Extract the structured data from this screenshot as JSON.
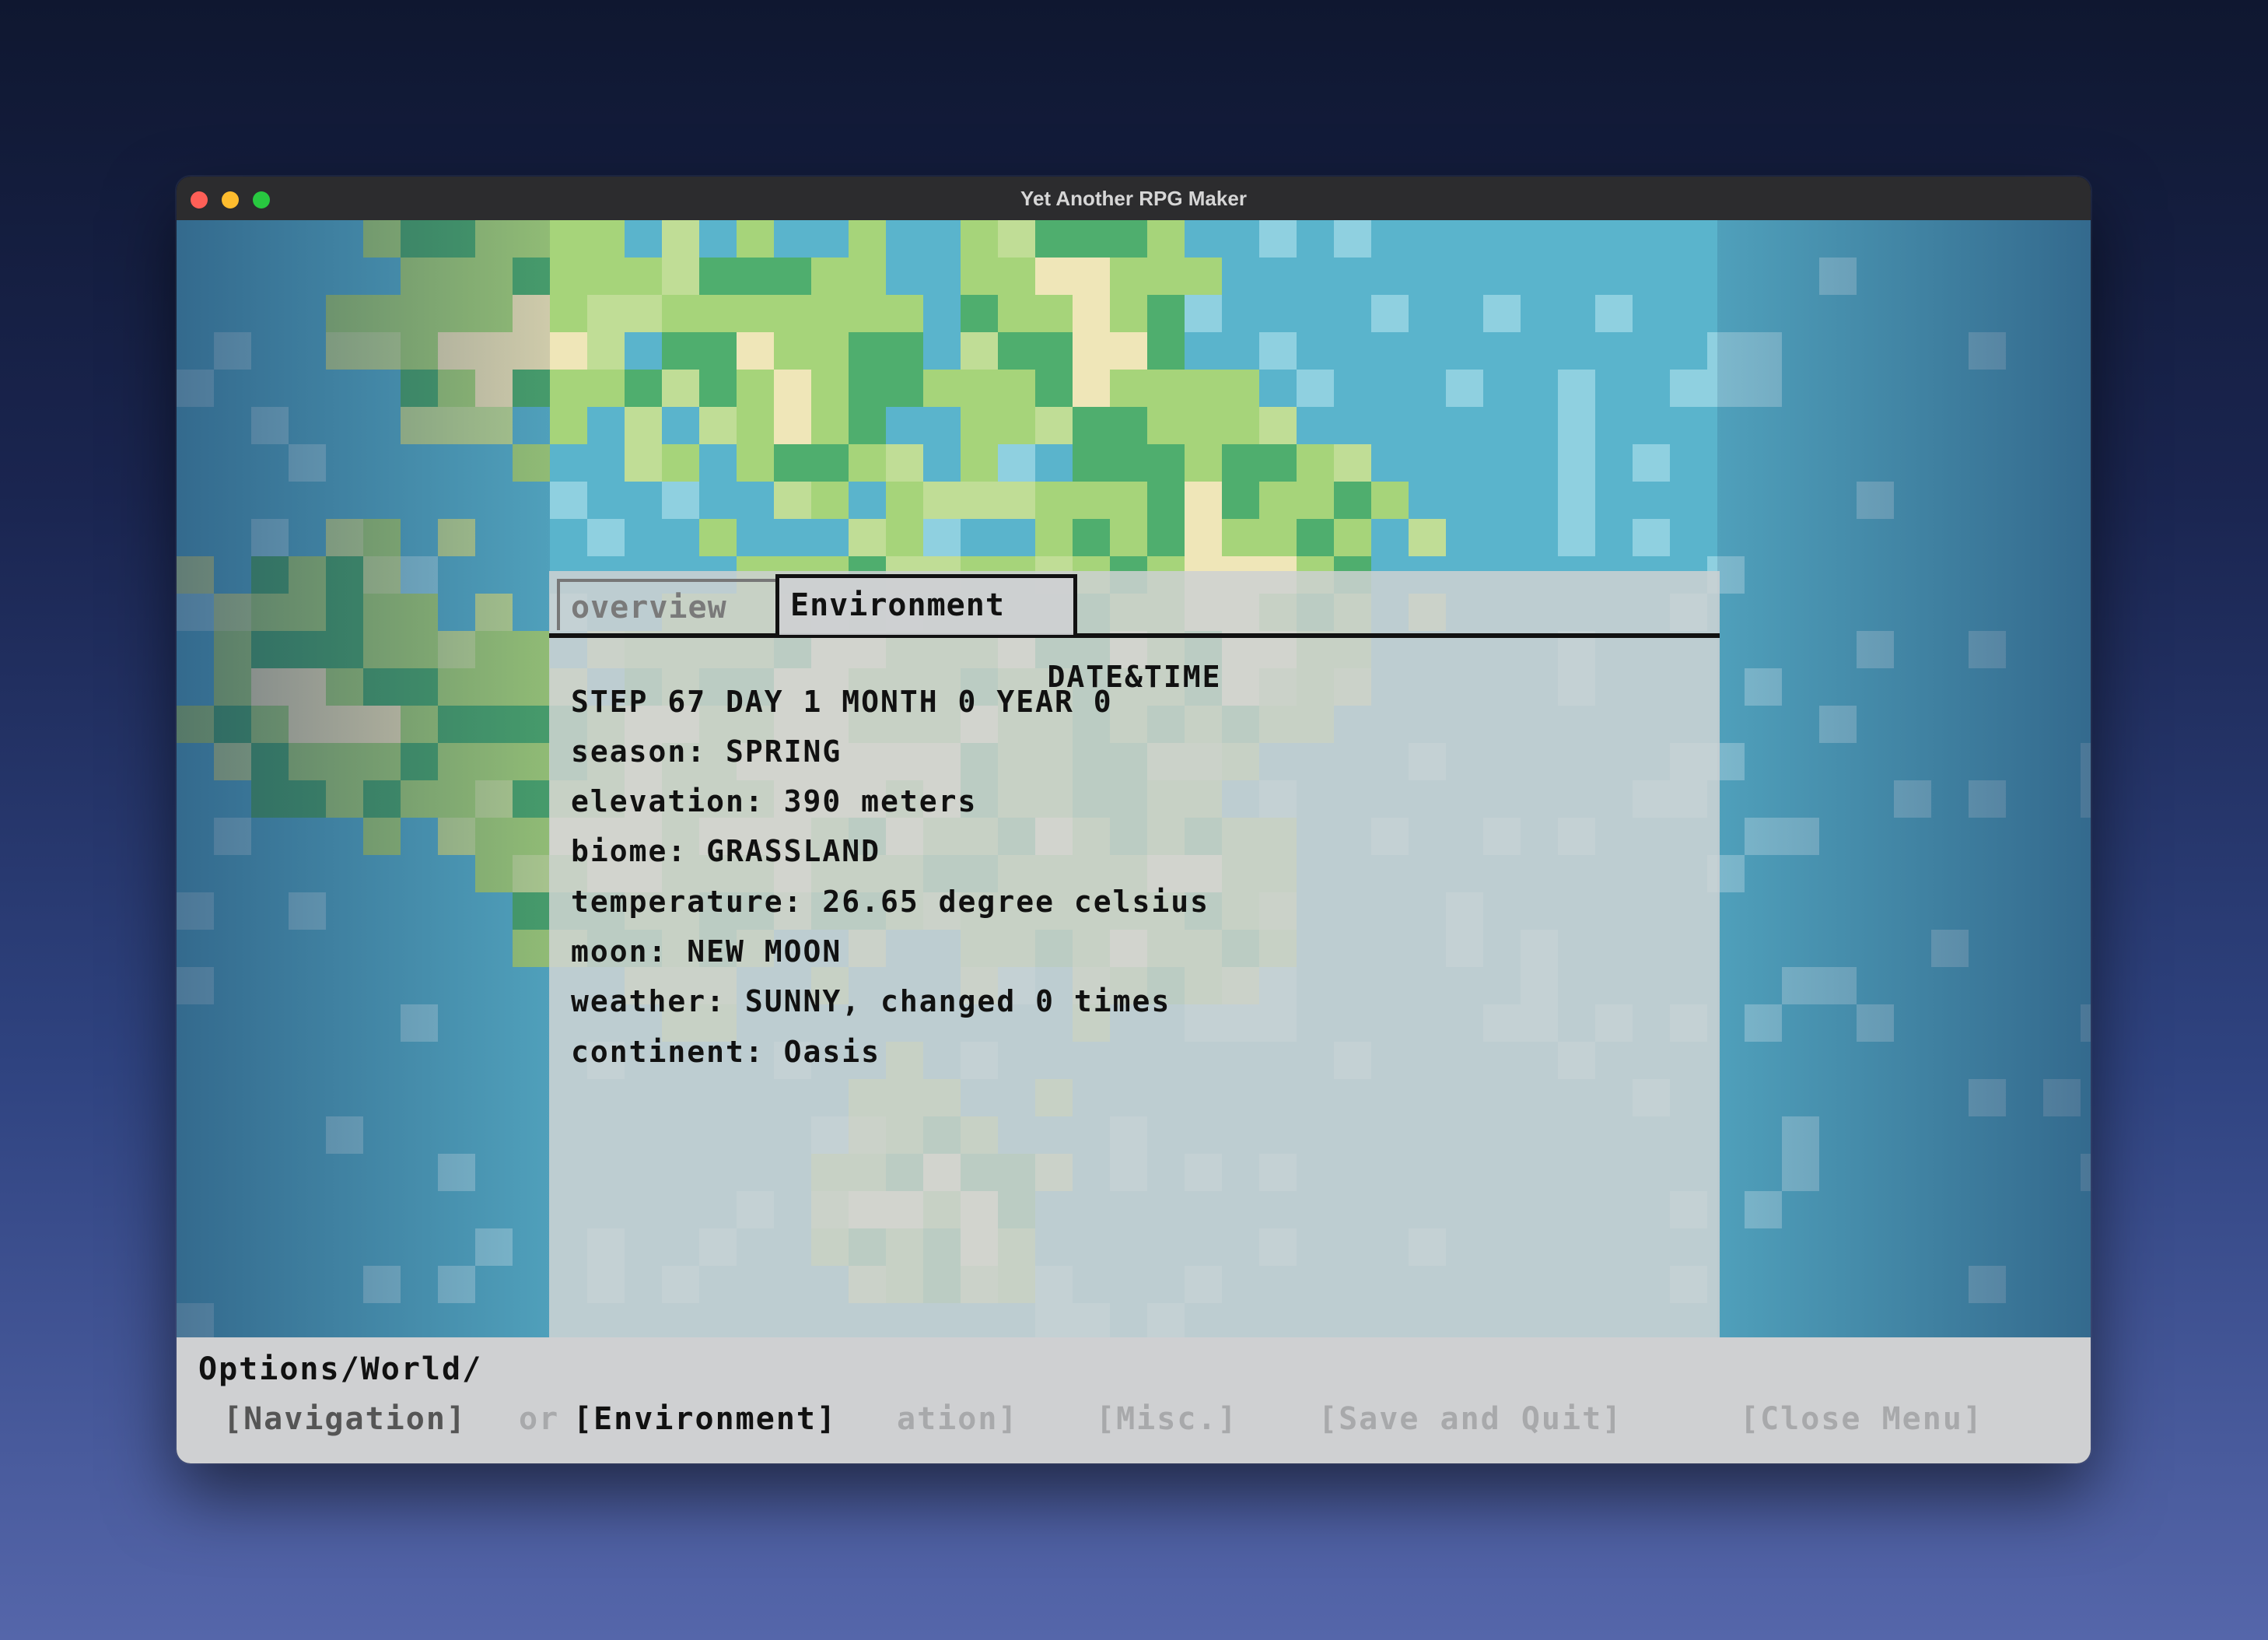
{
  "window": {
    "title": "Yet Another RPG Maker"
  },
  "tabs": [
    {
      "label": "overview",
      "active": false
    },
    {
      "label": "Environment",
      "active": true
    }
  ],
  "environment": {
    "section_title": "DATE&TIME",
    "lines": [
      "STEP 67 DAY 1 MONTH 0 YEAR 0",
      "season: SPRING",
      "elevation: 390 meters",
      "biome: GRASSLAND",
      "temperature: 26.65 degree celsius",
      "moon: NEW MOON",
      "weather: SUNNY, changed 0 times",
      "continent: Oasis"
    ]
  },
  "bottom_bar": {
    "path": "Options/World/",
    "menu": {
      "navigation": "[Navigation]",
      "behind_fragment": "or",
      "environment": "[Environment]",
      "information_fragment": "ation]",
      "misc": "[Misc.]",
      "save_quit": "[Save and Quit]",
      "close_menu": "[Close Menu]"
    }
  },
  "colors": {
    "water": "#5ab4cc",
    "deep_water": "#2e6494",
    "grass": "#a6d47a",
    "forest": "#4fae6e",
    "sand": "#efe6b8",
    "panel": "#cdd0d2",
    "text": "#111111"
  }
}
